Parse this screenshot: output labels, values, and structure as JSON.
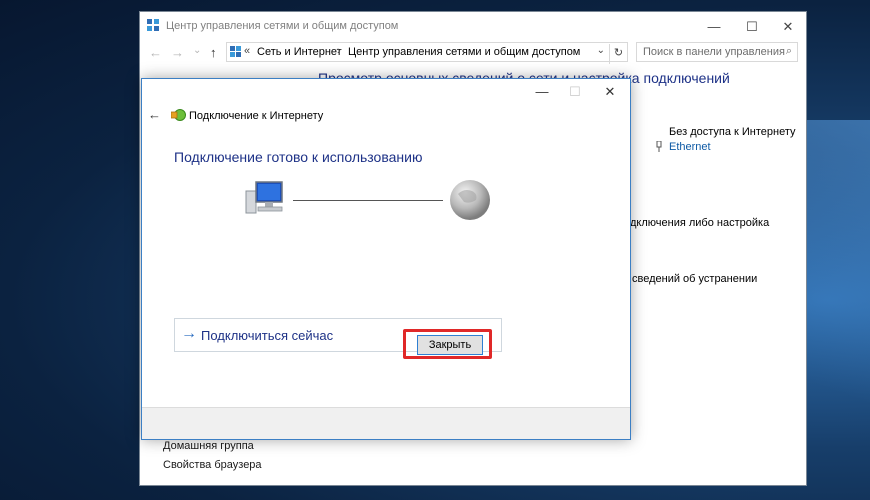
{
  "window": {
    "title": "Центр управления сетями и общим доступом",
    "minimize": "—",
    "maximize": "☐",
    "close": "✕"
  },
  "nav": {
    "back": "←",
    "forward": "→",
    "recent": "⌄",
    "up": "↑"
  },
  "address": {
    "prefix": "«",
    "segments": [
      "Сеть и Интернет",
      "Центр управления сетями и общим доступом"
    ],
    "separator": "›",
    "dropdown": "⌄",
    "refresh": "↻"
  },
  "search": {
    "placeholder": "Поиск в панели управления",
    "icon": "⌕"
  },
  "main": {
    "heading": "Просмотр основных сведений о сети и настройка подключений",
    "access_status": "Без доступа к Интернету",
    "connection_link": "Ethernet",
    "fragment_1": "дключения либо настройка",
    "fragment_2": "сведений об устранении"
  },
  "left_links": [
    "Домашняя группа",
    "Свойства браузера"
  ],
  "dialog": {
    "minimize": "—",
    "maximize": "☐",
    "close": "✕",
    "back": "←",
    "title": "Подключение к Интернету",
    "main_text": "Подключение готово к использованию",
    "connect_arrow": "→",
    "connect_label": "Подключиться сейчас",
    "close_button": "Закрыть"
  },
  "colors": {
    "heading": "#1e3287",
    "link": "#0e5aa5",
    "highlight": "#e02828",
    "dialog_border": "#3c7fc4"
  }
}
